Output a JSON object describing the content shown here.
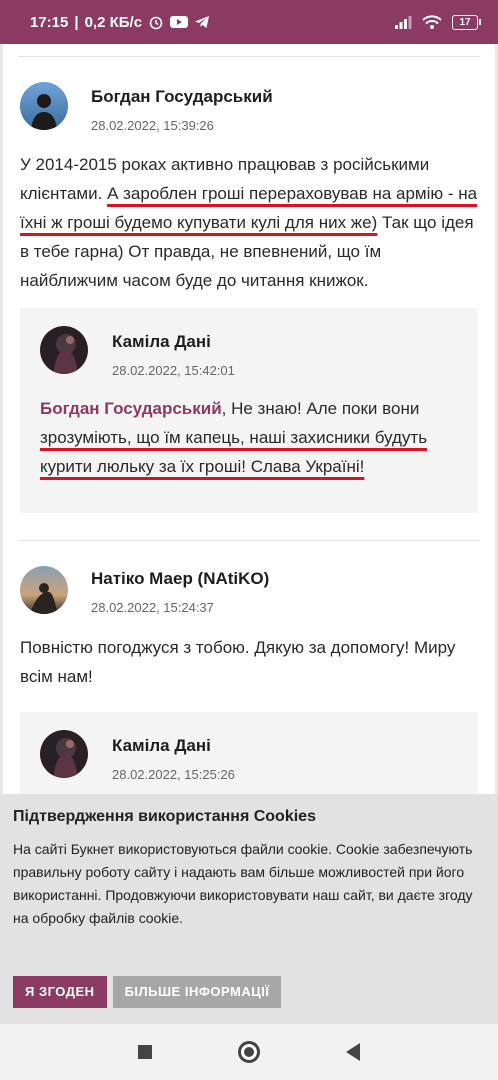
{
  "status_bar": {
    "time": "17:15",
    "speed": "0,2 КБ/с",
    "battery": "17"
  },
  "comments": [
    {
      "author": "Богдан Государський",
      "date": "28.02.2022, 15:39:26",
      "text_plain_1": "У 2014-2015 роках активно працював з російськими клієнтами. ",
      "text_underlined": "А зароблен гроші перераховував на армію - на їхні ж гроші будемо купувати кулі для них же)",
      "text_plain_2": " Так що ідея в тебе гарна) От правда, не впевнений, що їм найближчим часом буде до читання книжок.",
      "reply": {
        "author": "Каміла Дані",
        "date": "28.02.2022, 15:42:01",
        "mention": "Богдан Государський",
        "text_plain": ", Не знаю! Але поки вони ",
        "text_underlined": "зрозуміють, що їм капець, наші захисники будуть курити люльку за їх гроші! Слава Україні!"
      }
    },
    {
      "author": "Натіко Маер (NAtiKO)",
      "date": "28.02.2022, 15:24:37",
      "text": "Повністю погоджуся з тобою. Дякую за допомогу! Миру всім нам!",
      "reply": {
        "author": "Каміла Дані",
        "date": "28.02.2022, 15:25:26"
      }
    }
  ],
  "cookie": {
    "title": "Підтвердження використання Cookies",
    "text": "На сайті Букнет використовуються файли cookie. Cookie забезпечують правильну роботу сайту і надають вам більше можливостей при його використанні. Продовжуючи використовувати наш сайт, ви даєте згоду на обробку файлів cookie.",
    "agree_label": "Я ЗГОДЕН",
    "more_label": "БІЛЬШЕ ІНФОРМАЦІЇ"
  },
  "colors": {
    "accent": "#8b3a62",
    "underline": "#d8141e"
  }
}
